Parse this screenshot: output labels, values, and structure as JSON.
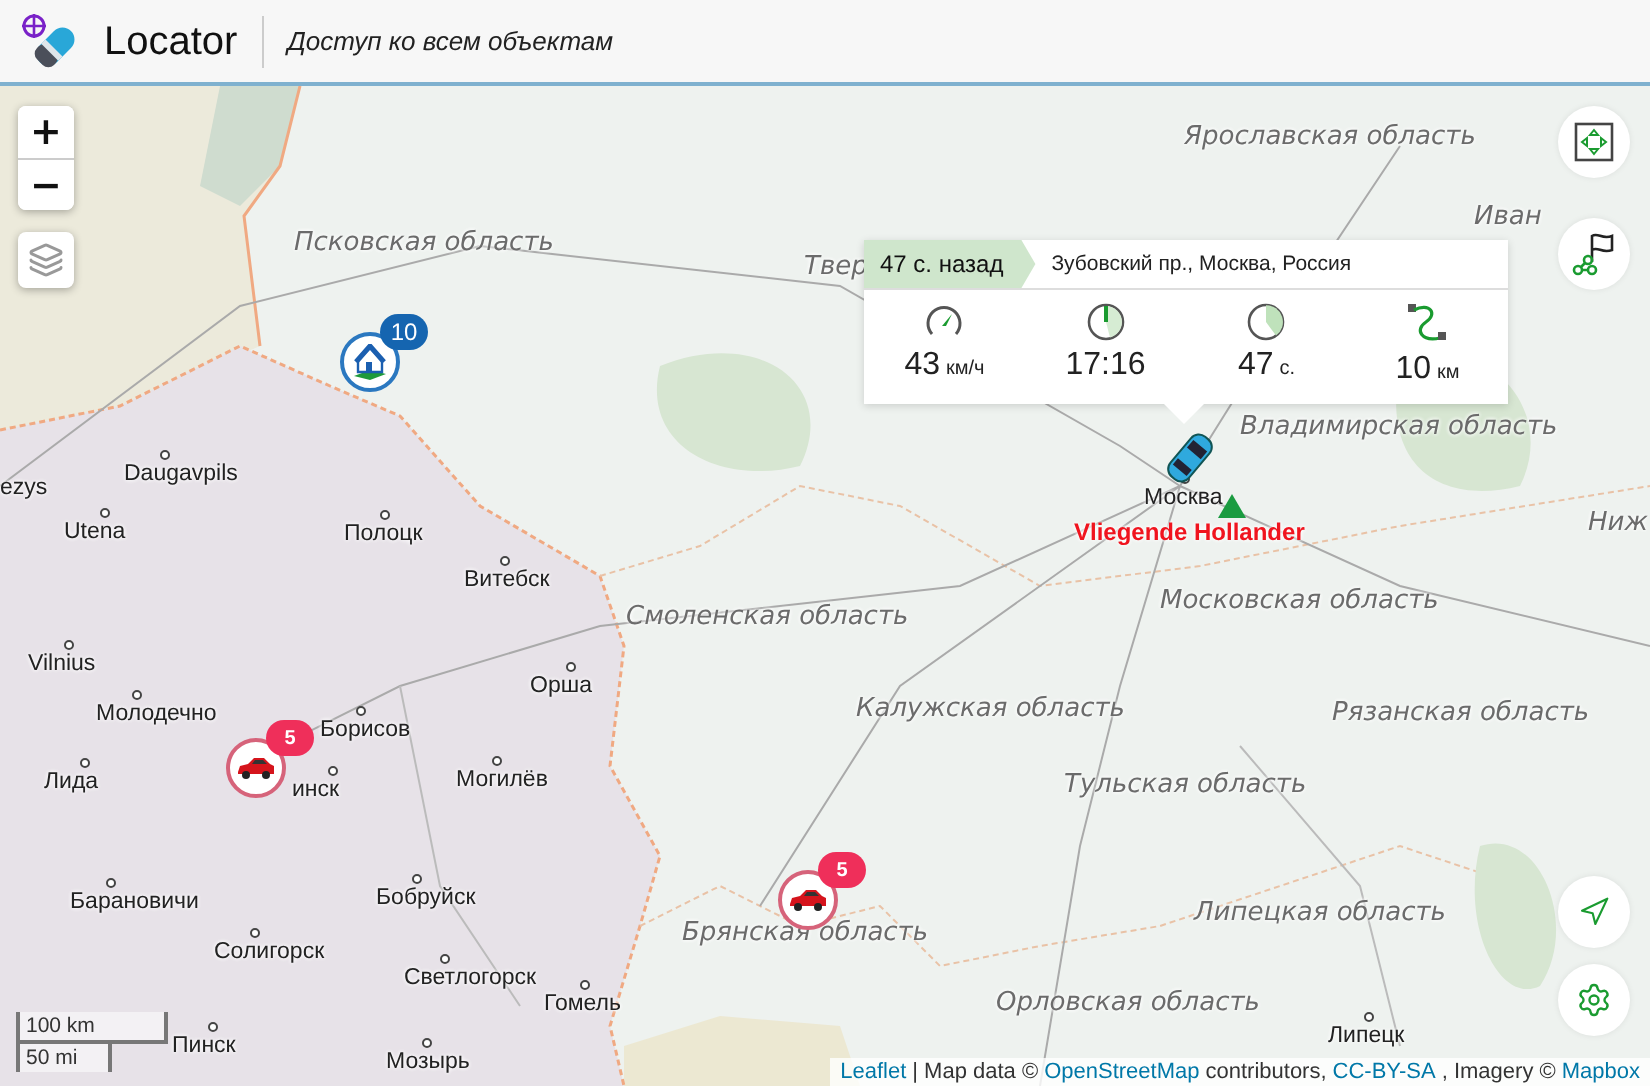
{
  "header": {
    "title": "Locator",
    "subtitle": "Доступ ко всем объектам"
  },
  "zoom": {
    "zoom_in": "+",
    "zoom_out": "−"
  },
  "map": {
    "labels": [
      {
        "text": "Псковская область",
        "kind": "region"
      },
      {
        "text": "Твер",
        "kind": "region"
      },
      {
        "text": "Ярославская область",
        "kind": "region"
      },
      {
        "text": "Иван",
        "kind": "region"
      },
      {
        "text": "Владимирская область",
        "kind": "region"
      },
      {
        "text": "Смоленская область",
        "kind": "region"
      },
      {
        "text": "Московская область",
        "kind": "region"
      },
      {
        "text": "Калужская область",
        "kind": "region"
      },
      {
        "text": "Рязанская область",
        "kind": "region"
      },
      {
        "text": "Тульская область",
        "kind": "region"
      },
      {
        "text": "Брянская область",
        "kind": "region"
      },
      {
        "text": "Липецкая область",
        "kind": "region"
      },
      {
        "text": "Орловская область",
        "kind": "region"
      },
      {
        "text": "Ниж",
        "kind": "region"
      },
      {
        "text": "ezys",
        "kind": "city"
      },
      {
        "text": "Daugavpils",
        "kind": "city"
      },
      {
        "text": "Utena",
        "kind": "city"
      },
      {
        "text": "Vilnius",
        "kind": "city"
      },
      {
        "text": "Лида",
        "kind": "city"
      },
      {
        "text": "Полоцк",
        "kind": "city"
      },
      {
        "text": "Витебск",
        "kind": "city"
      },
      {
        "text": "Орша",
        "kind": "city"
      },
      {
        "text": "Молодечно",
        "kind": "city"
      },
      {
        "text": "Борисов",
        "kind": "city"
      },
      {
        "text": "инск",
        "kind": "city"
      },
      {
        "text": "Могилёв",
        "kind": "city"
      },
      {
        "text": "Барановичи",
        "kind": "city"
      },
      {
        "text": "Бобруйск",
        "kind": "city"
      },
      {
        "text": "Солигорск",
        "kind": "city"
      },
      {
        "text": "Светлогорск",
        "kind": "city"
      },
      {
        "text": "Гомель",
        "kind": "city"
      },
      {
        "text": "Пинск",
        "kind": "city"
      },
      {
        "text": "Мозырь",
        "kind": "city"
      },
      {
        "text": "Москва",
        "kind": "city"
      },
      {
        "text": "Липецк",
        "kind": "city"
      }
    ],
    "clusters": [
      {
        "kind": "place",
        "count": "10"
      },
      {
        "kind": "vehicle",
        "count": "5"
      },
      {
        "kind": "vehicle",
        "count": "5"
      }
    ],
    "vehicle": {
      "name": "Vliegende Hollander"
    }
  },
  "popup": {
    "time_ago": "47 с. назад",
    "address": "Зубовский пр., Москва, Россия",
    "stats": [
      {
        "kind": "speed",
        "value": "43",
        "unit": "км/ч"
      },
      {
        "kind": "time",
        "value": "17:16"
      },
      {
        "kind": "duration",
        "value": "47",
        "unit": "с."
      },
      {
        "kind": "distance",
        "value": "10",
        "unit": "км"
      }
    ]
  },
  "scale": {
    "metric": "100 km",
    "imperial": "50 mi"
  },
  "attribution": [
    {
      "text": "Leaflet",
      "link": true
    },
    {
      "text": "| Map data ©",
      "link": false
    },
    {
      "text": "OpenStreetMap",
      "link": true
    },
    {
      "text": "contributors,",
      "link": false
    },
    {
      "text": "CC-BY-SA",
      "link": true
    },
    {
      "text": ", Imagery ©",
      "link": false
    },
    {
      "text": "Mapbox",
      "link": true
    }
  ]
}
